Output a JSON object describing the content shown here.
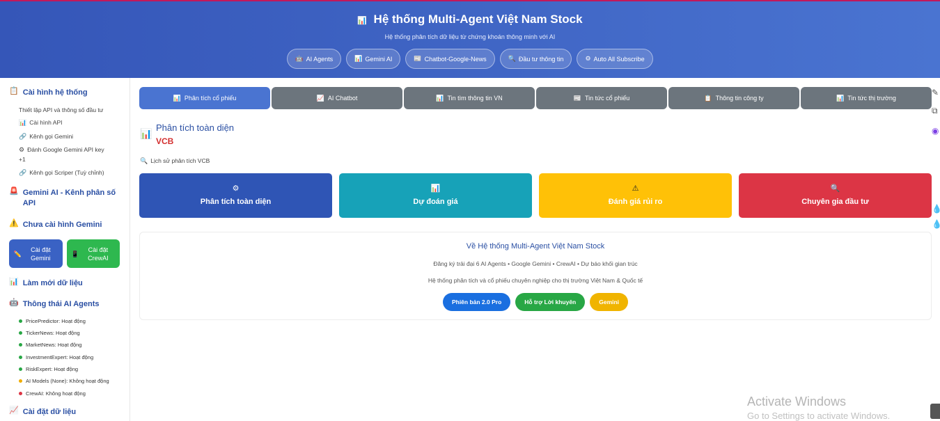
{
  "header": {
    "title_icon": "📊",
    "title": "Hệ thống Multi-Agent Việt Nam Stock",
    "subtitle": "Hệ thống phân tích dữ liệu từ chứng khoán thông minh với AI",
    "nav": [
      {
        "icon": "🤖",
        "label": "AI Agents"
      },
      {
        "icon": "📊",
        "label": "Gemini AI"
      },
      {
        "icon": "📰",
        "label": "Chatbot-Google-News"
      },
      {
        "icon": "🔍",
        "label": "Đầu tư thông tin"
      },
      {
        "icon": "⚙",
        "label": "Auto All Subscribe"
      }
    ]
  },
  "sidebar": {
    "config_title": "Cài hình hệ thống",
    "config_desc": "Thiết lập API và thông số đầu tư",
    "config_items": [
      {
        "icon": "📊",
        "label": "Cài hình API"
      },
      {
        "icon": "🔗",
        "label": "Kênh gọi Gemini"
      },
      {
        "icon": "⚙",
        "label": "Đánh Google Gemini API key"
      },
      {
        "icon": "🔗",
        "label": "Kênh gọi Scriper (Tuỳ chỉnh)"
      }
    ],
    "config_plus": "+1",
    "gemini_title": "Gemini AI - Kênh phân số API",
    "warning": "Chưa cài hình Gemini",
    "btn_gemini": "Cài đặt Gemini",
    "btn_crewai": "Cài đặt CrewAI",
    "refresh": "Làm mới dữ liệu",
    "agents_title": "Thông thái AI Agents",
    "agents": [
      {
        "label": "PricePredictor: Hoạt động",
        "color": "#28a745"
      },
      {
        "label": "TickerNews: Hoạt động",
        "color": "#28a745"
      },
      {
        "label": "MarketNews: Hoạt động",
        "color": "#28a745"
      },
      {
        "label": "InvestmentExpert: Hoạt động",
        "color": "#28a745"
      },
      {
        "label": "RiskExpert: Hoạt động",
        "color": "#28a745"
      },
      {
        "label": "AI Models (None): Không hoạt động",
        "color": "#f0ad00"
      },
      {
        "label": "CrewAI: Không hoạt động",
        "color": "#dc3545"
      }
    ],
    "data_settings": "Cài đặt dữ liệu"
  },
  "tabs": [
    {
      "icon": "📊",
      "label": "Phân tích cổ phiếu",
      "active": true
    },
    {
      "icon": "📈",
      "label": "AI Chatbot"
    },
    {
      "icon": "📊",
      "label": "Tin tìm thông tin VN"
    },
    {
      "icon": "📰",
      "label": "Tin tức cổ phiếu"
    },
    {
      "icon": "📋",
      "label": "Thông tin công ty"
    },
    {
      "icon": "📊",
      "label": "Tin tức thị trường"
    }
  ],
  "section": {
    "icon": "📊",
    "title": "Phân tích toàn diện",
    "ticker": "VCB",
    "history": "Lịch sử phân tích VCB"
  },
  "cards": [
    {
      "icon": "⚙",
      "label": "Phân tích toàn diện",
      "color": "#2f55b5"
    },
    {
      "icon": "📊",
      "label": "Dự đoán giá",
      "color": "#17a2b8"
    },
    {
      "icon": "⚠",
      "label": "Đánh giá rủi ro",
      "color": "#ffc107"
    },
    {
      "icon": "🔍",
      "label": "Chuyên gia đầu tư",
      "color": "#dc3545"
    }
  ],
  "about": {
    "title": "Về Hệ thống Multi-Agent Việt Nam Stock",
    "line1": "Đăng ký trải đại 6 AI Agents • Google Gemini • CrewAI • Dự báo khối gian trúc",
    "line2": "Hệ thống phân tích và cổ phiếu chuyên nghiệp cho thị trường Việt Nam & Quốc tế",
    "pills": [
      {
        "label": "Phiên bản 2.0 Pro",
        "color": "#1a6fe0"
      },
      {
        "label": "Hỗ trợ Lời khuyên",
        "color": "#28a745"
      },
      {
        "label": "Gemini",
        "color": "#f0b400"
      }
    ]
  },
  "watermark": {
    "line1": "Activate Windows",
    "line2": "Go to Settings to activate Windows."
  }
}
